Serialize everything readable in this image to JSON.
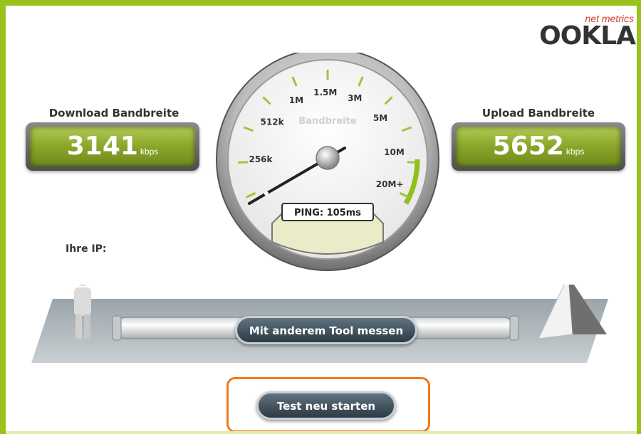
{
  "logo": {
    "tagline": "net metrics",
    "brand": "OOKLA"
  },
  "download": {
    "label": "Download Bandbreite",
    "value": "3141",
    "unit": "kbps"
  },
  "upload": {
    "label": "Upload Bandbreite",
    "value": "5652",
    "unit": "kbps"
  },
  "gauge": {
    "title": "Bandbreite",
    "ticks": [
      "256k",
      "512k",
      "1M",
      "1.5M",
      "3M",
      "5M",
      "10M",
      "20M+"
    ],
    "ping_label": "PING: 105ms"
  },
  "ip": {
    "label": "Ihre IP:"
  },
  "buttons": {
    "other_tool": "Mit anderem Tool messen",
    "restart": "Test neu starten"
  },
  "colors": {
    "frame": "#99c21c",
    "meter": "#8aa52a",
    "highlight": "#f07a1c"
  }
}
